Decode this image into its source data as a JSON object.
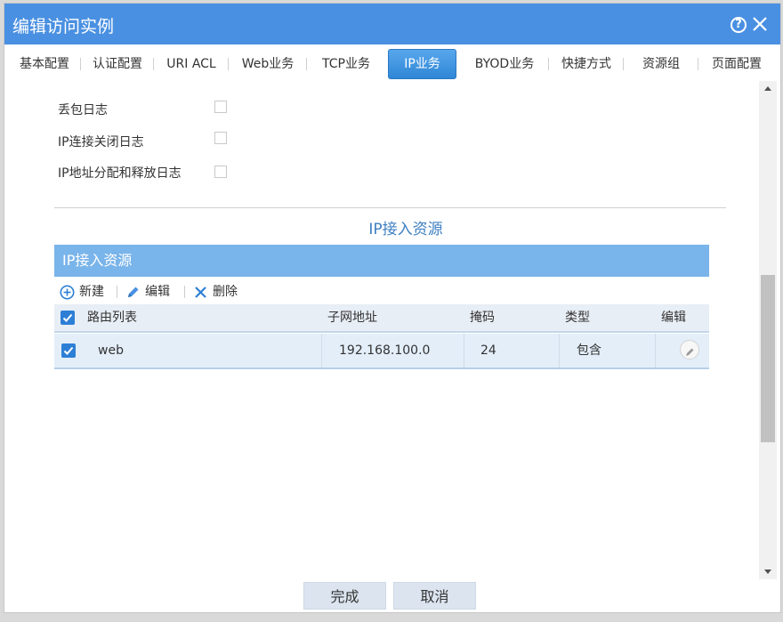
{
  "dialog": {
    "title": "编辑访问实例"
  },
  "tabs": [
    {
      "label": "基本配置"
    },
    {
      "label": "认证配置"
    },
    {
      "label": "URI ACL"
    },
    {
      "label": "Web业务"
    },
    {
      "label": "TCP业务"
    },
    {
      "label": "IP业务",
      "active": true
    },
    {
      "label": "BYOD业务"
    },
    {
      "label": "快捷方式"
    },
    {
      "label": "资源组"
    },
    {
      "label": "页面配置"
    }
  ],
  "options": [
    {
      "label": "丢包日志",
      "checked": false
    },
    {
      "label": "IP连接关闭日志",
      "checked": false
    },
    {
      "label": "IP地址分配和释放日志",
      "checked": false
    }
  ],
  "section": {
    "title": "IP接入资源"
  },
  "panel": {
    "title": "IP接入资源",
    "toolbar": {
      "new": "新建",
      "edit": "编辑",
      "delete": "删除"
    },
    "columns": [
      "路由列表",
      "子网地址",
      "掩码",
      "类型",
      "编辑"
    ],
    "rows": [
      {
        "name": "web",
        "subnet": "192.168.100.0",
        "mask": "24",
        "type": "包含",
        "checked": true
      }
    ]
  },
  "footer": {
    "ok": "完成",
    "cancel": "取消"
  },
  "colors": {
    "titlebar": "#4a90e2",
    "accent": "#2d7fd6",
    "panel_header": "#79b4ea"
  }
}
